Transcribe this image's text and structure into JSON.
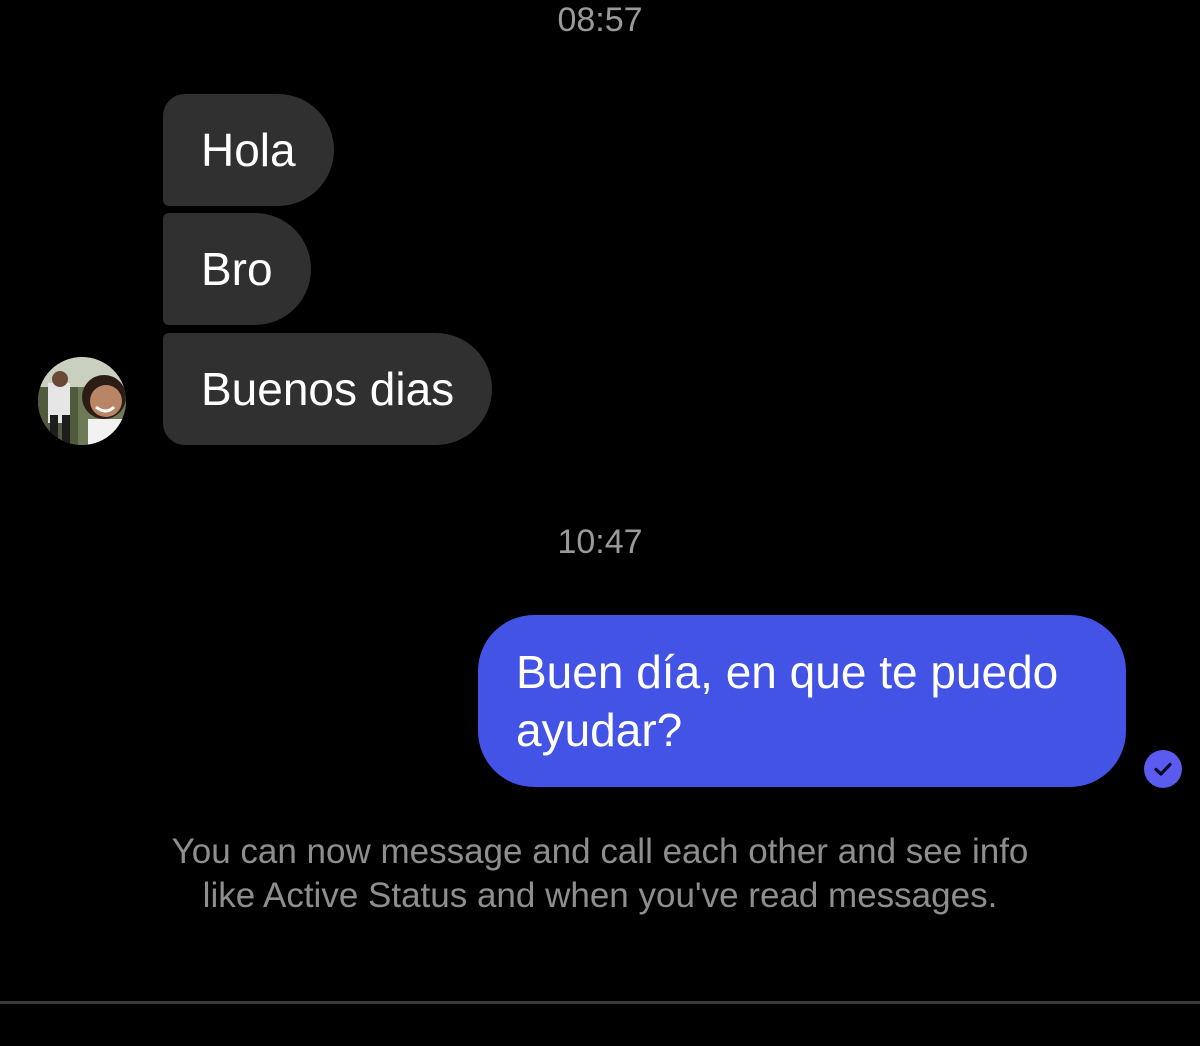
{
  "conversation": {
    "timestamps": [
      "08:57",
      "10:47"
    ],
    "incoming_messages": [
      "Hola",
      "Bro",
      "Buenos dias"
    ],
    "outgoing_message": "Buen día, en que te puedo ayudar?",
    "info_notice": "You can now message and call each other and see info like Active Status and when you've read messages."
  },
  "icons": {
    "avatar": "contact-avatar",
    "read_receipt": "check-circle-icon"
  },
  "colors": {
    "background": "#000000",
    "incoming_bubble": "#303030",
    "outgoing_bubble": "#4353e6",
    "read_receipt": "#5b5bf0",
    "timestamp_text": "#9a9a9a",
    "info_text": "#8e8e8e"
  }
}
